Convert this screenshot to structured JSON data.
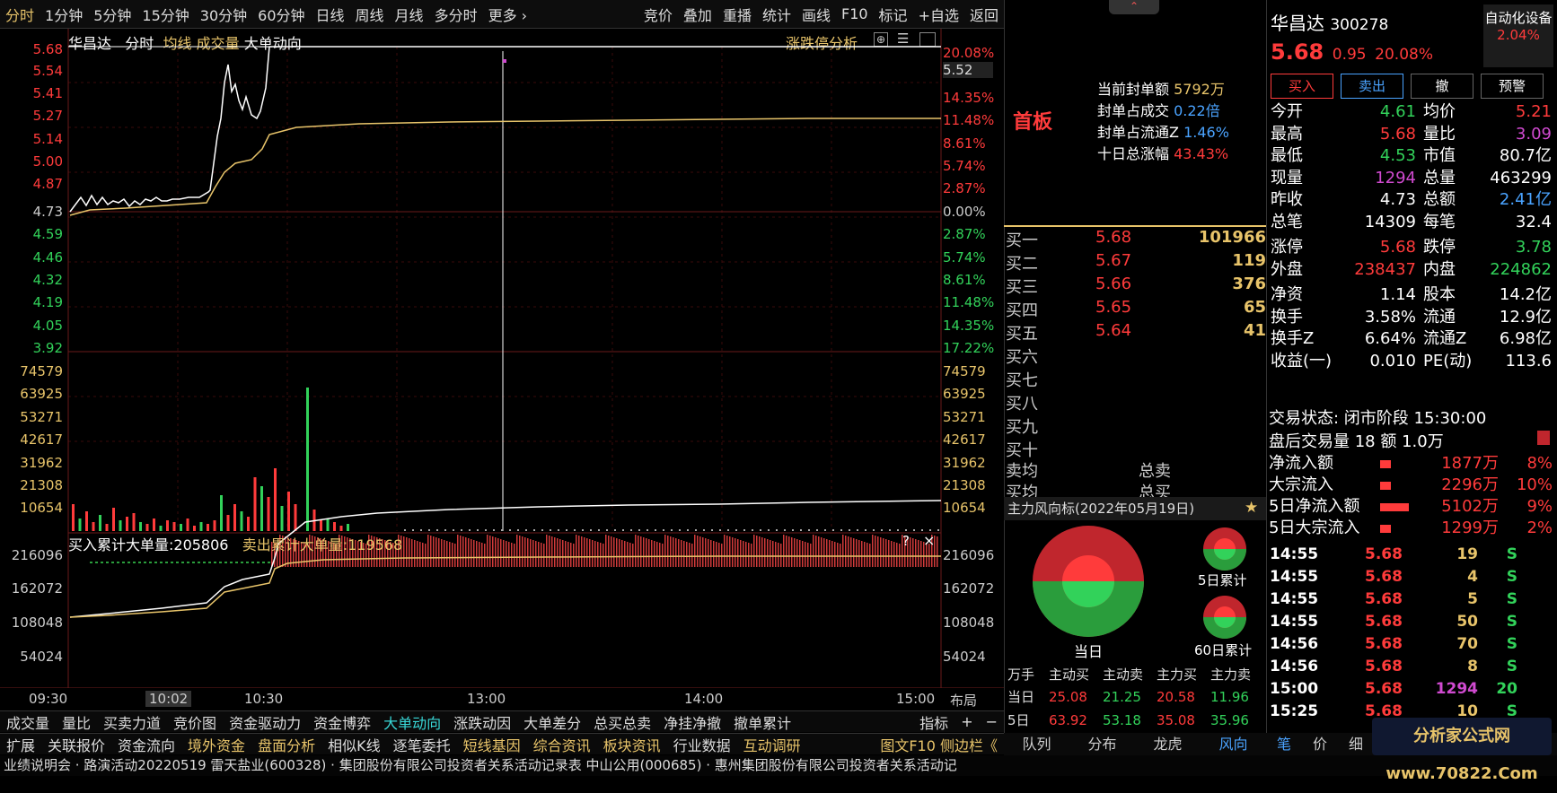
{
  "top_tabs": [
    "分时",
    "1分钟",
    "5分钟",
    "15分钟",
    "30分钟",
    "60分钟",
    "日线",
    "周线",
    "月线",
    "多分时",
    "更多 ›"
  ],
  "top_tools": [
    "竞价",
    "叠加",
    "重播",
    "统计",
    "画线",
    "F10",
    "标记",
    "+自选",
    "返回"
  ],
  "chart_header": {
    "name": "华昌达",
    "mode": "分时",
    "avg": "均线",
    "vol": "成交量",
    "big": "大单动向",
    "right": "涨跌停分析"
  },
  "price_axis": [
    "5.68",
    "5.54",
    "5.41",
    "5.27",
    "5.14",
    "5.00",
    "4.87",
    "4.73",
    "4.59",
    "4.46",
    "4.32",
    "4.19",
    "4.05",
    "3.92"
  ],
  "pct_axis": [
    "20.08%",
    "14.35%",
    "11.48%",
    "8.61%",
    "5.74%",
    "2.87%",
    "0.00%",
    "2.87%",
    "5.74%",
    "8.61%",
    "11.48%",
    "14.35%",
    "17.22%"
  ],
  "cursor_price": "5.52",
  "vol_axis": [
    "74579",
    "63925",
    "53271",
    "42617",
    "31962",
    "21308",
    "10654"
  ],
  "big_panel": {
    "buy": "买入累计大单量:205806",
    "sell": "卖出累计大单量:119568",
    "axis": [
      "216096",
      "162072",
      "108048",
      "54024"
    ]
  },
  "time_axis": [
    "09:30",
    "10:02",
    "10:30",
    "13:00",
    "14:00",
    "15:00"
  ],
  "layout_btn": "布局",
  "indicator_tabs": [
    "成交量",
    "量比",
    "买卖力道",
    "竞价图",
    "资金驱动力",
    "资金博弈",
    "大单动向",
    "涨跌动因",
    "大单差分",
    "总买总卖",
    "净挂净撤",
    "撤单累计"
  ],
  "indicator_right": [
    "指标",
    "+",
    "−"
  ],
  "bottom_tabs": [
    "扩展",
    "关联报价",
    "资金流向",
    "境外资金",
    "盘面分析",
    "相似K线",
    "逐笔委托",
    "短线基因",
    "综合资讯",
    "板块资讯",
    "行业数据",
    "互动调研"
  ],
  "bottom_right": "图文F10 侧边栏《",
  "news_line": "业绩说明会 · 路演活动20220519    雷天盐业(600328) · 集团股份有限公司投资者关系活动记录表    中山公用(000685) · 惠州集团股份有限公司投资者关系活动记",
  "seal": {
    "tag": "首板",
    "amount_l": "当前封单额",
    "amount": "5792万",
    "ratio_l": "封单占成交",
    "ratio": "0.22倍",
    "float_l": "封单占流通Z",
    "float": "1.46%",
    "ten_l": "十日总涨幅",
    "ten": "43.43%"
  },
  "book": [
    {
      "l": "买一",
      "p": "5.68",
      "v": "101966"
    },
    {
      "l": "买二",
      "p": "5.67",
      "v": "119"
    },
    {
      "l": "买三",
      "p": "5.66",
      "v": "376"
    },
    {
      "l": "买四",
      "p": "5.65",
      "v": "65"
    },
    {
      "l": "买五",
      "p": "5.64",
      "v": "41"
    },
    {
      "l": "买六",
      "p": "",
      "v": ""
    },
    {
      "l": "买七",
      "p": "",
      "v": ""
    },
    {
      "l": "买八",
      "p": "",
      "v": ""
    },
    {
      "l": "买九",
      "p": "",
      "v": ""
    },
    {
      "l": "买十",
      "p": "",
      "v": ""
    }
  ],
  "avg_sell": "卖均",
  "avg_buy": "买均",
  "total_sell": "总卖",
  "total_buy": "总买",
  "flow_panel": {
    "title": "主力风向标(2022年05月19日)",
    "today": "当日",
    "five": "5日累计",
    "sixty": "60日累计",
    "heads": [
      "万手",
      "主动买",
      "主动卖",
      "主力买",
      "主力卖"
    ],
    "rows": [
      [
        "当日",
        "25.08",
        "21.25",
        "20.58",
        "11.96"
      ],
      [
        "5日",
        "63.92",
        "53.18",
        "35.08",
        "35.96"
      ]
    ]
  },
  "stock": {
    "name": "华昌达",
    "code": "300278",
    "price": "5.68",
    "chg": "0.95",
    "pct": "20.08%",
    "sector": "自动化设备",
    "sector_pct": "2.04%"
  },
  "actions": [
    "买入",
    "卖出",
    "撤",
    "预警"
  ],
  "quote": [
    [
      "今开",
      "4.61",
      "均价",
      "5.21"
    ],
    [
      "最高",
      "5.68",
      "量比",
      "3.09"
    ],
    [
      "最低",
      "4.53",
      "市值",
      "80.7亿"
    ],
    [
      "现量",
      "1294",
      "总量",
      "463299"
    ],
    [
      "昨收",
      "4.73",
      "总额",
      "2.41亿"
    ],
    [
      "总笔",
      "14309",
      "每笔",
      "32.4"
    ],
    [
      "涨停",
      "5.68",
      "跌停",
      "3.78"
    ],
    [
      "外盘",
      "238437",
      "内盘",
      "224862"
    ],
    [
      "净资",
      "1.14",
      "股本",
      "14.2亿"
    ],
    [
      "换手",
      "3.58%",
      "流通",
      "12.9亿"
    ],
    [
      "换手Z",
      "6.64%",
      "流通Z",
      "6.98亿"
    ],
    [
      "收益(一)",
      "0.010",
      "PE(动)",
      "113.6"
    ]
  ],
  "trade_status": "交易状态: 闭市阶段 15:30:00",
  "after_hours": "盘后交易量 18 额 1.0万",
  "net_flow": [
    [
      "净流入额",
      "1877万",
      "8%"
    ],
    [
      "大宗流入",
      "2296万",
      "10%"
    ],
    [
      "5日净流入额",
      "5102万",
      "9%"
    ],
    [
      "5日大宗流入",
      "1299万",
      "2%"
    ]
  ],
  "ticks": [
    [
      "14:55",
      "5.68",
      "19",
      "S"
    ],
    [
      "14:55",
      "5.68",
      "4",
      "S"
    ],
    [
      "14:55",
      "5.68",
      "5",
      "S"
    ],
    [
      "14:55",
      "5.68",
      "50",
      "S"
    ],
    [
      "14:56",
      "5.68",
      "70",
      "S"
    ],
    [
      "14:56",
      "5.68",
      "8",
      "S"
    ],
    [
      "15:00",
      "5.68",
      "1294",
      "20"
    ],
    [
      "15:25",
      "5.68",
      "10",
      "S"
    ]
  ],
  "right_tabs": [
    "队列",
    "分布",
    "龙虎",
    "风向"
  ],
  "far_tabs": [
    "笔",
    "价",
    "细"
  ],
  "watermark": "分析家公式网 www.70822.Com",
  "colors": {
    "up": "#ff3b3b",
    "down": "#32d25a",
    "gold": "#e8c46a"
  }
}
